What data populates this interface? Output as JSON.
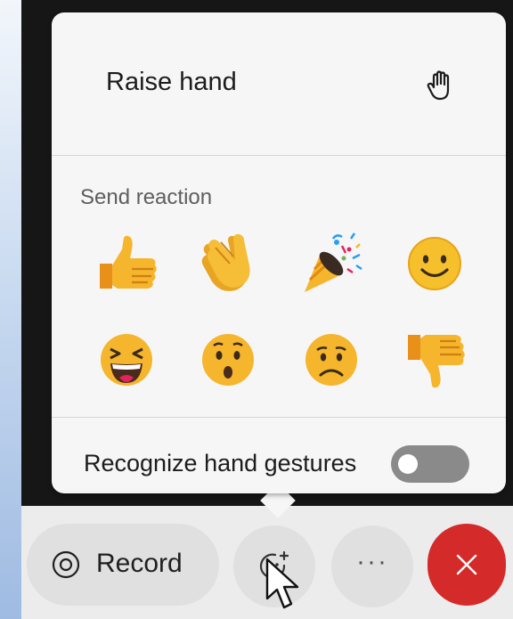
{
  "reaction_menu": {
    "raise_hand_label": "Raise hand",
    "raise_hand_icon": "hand-icon",
    "send_reaction_label": "Send reaction",
    "reactions": [
      {
        "name": "like",
        "icon": "thumbs-up-icon"
      },
      {
        "name": "applause",
        "icon": "clapping-hands-icon"
      },
      {
        "name": "celebrate",
        "icon": "party-popper-icon"
      },
      {
        "name": "smile",
        "icon": "smiling-face-icon"
      },
      {
        "name": "laugh",
        "icon": "laughing-face-icon"
      },
      {
        "name": "surprised",
        "icon": "surprised-face-icon"
      },
      {
        "name": "sad",
        "icon": "sad-face-icon"
      },
      {
        "name": "dislike",
        "icon": "thumbs-down-icon"
      }
    ],
    "gestures_label": "Recognize hand gestures",
    "gestures_enabled": false
  },
  "controls": {
    "record_label": "Record",
    "more_label": "···",
    "reactions_icon": "reactions-icon",
    "leave_icon": "close-icon"
  },
  "colors": {
    "emoji_yellow": "#f5b52c",
    "leave_red": "#d42a2a",
    "toggle_off": "#8a8a8a"
  }
}
